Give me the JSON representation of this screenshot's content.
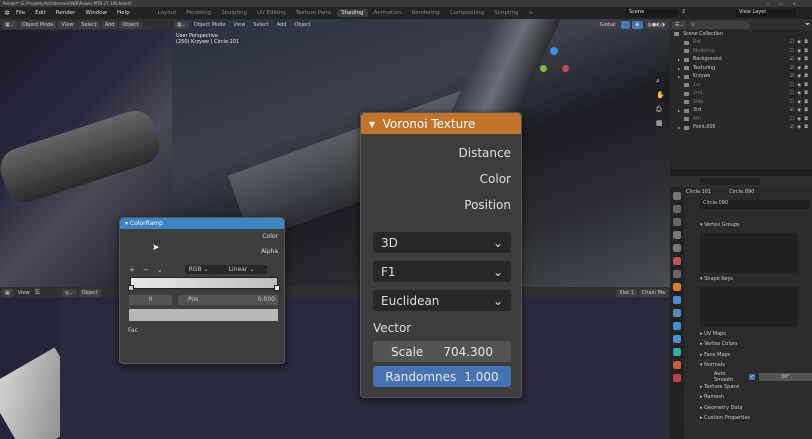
{
  "window": {
    "title": "Render* [E:\\Projekty\\Architecture\\PBR\\Rower MTB 27 100.blend]",
    "controls": [
      "─",
      "☐",
      "✕"
    ]
  },
  "menu": [
    "File",
    "Edit",
    "Render",
    "Window",
    "Help"
  ],
  "workspaces": [
    "Layout",
    "Modeling",
    "Sculpting",
    "UV Editing",
    "Texture Paint",
    "Shading",
    "Animation",
    "Rendering",
    "Compositing",
    "Scripting"
  ],
  "active_workspace": "Shading",
  "scene": {
    "name": "Scene",
    "users": "2",
    "view_layer": "View Layer"
  },
  "left_viewport": {
    "mode": "Object Mode",
    "menus": [
      "View",
      "Select",
      "Add",
      "Object"
    ]
  },
  "main_viewport": {
    "mode": "Object Mode",
    "menus": [
      "View",
      "Select",
      "Add",
      "Object"
    ],
    "orientation": "Global",
    "info_line1": "User Perspective",
    "info_line2": "(250) Krzywe | Circle.101"
  },
  "small_viewport": {
    "menu": "View"
  },
  "node_editor": {
    "mode": "Object",
    "slot": "Slot 1",
    "material": "Chain Ma"
  },
  "outliner": {
    "root": "Scene Collection",
    "items": [
      {
        "label": "Ref",
        "enabled": false
      },
      {
        "label": "Modeling",
        "enabled": false
      },
      {
        "label": "Background",
        "enabled": true
      },
      {
        "label": "Texturing",
        "enabled": true
      },
      {
        "label": "Krzywe",
        "enabled": true
      },
      {
        "label": "1st",
        "enabled": false
      },
      {
        "label": "2nd",
        "enabled": false
      },
      {
        "label": "Side",
        "enabled": false
      },
      {
        "label": "3rd",
        "enabled": true
      },
      {
        "label": "4th",
        "enabled": false
      },
      {
        "label": "Point.005",
        "enabled": true
      }
    ]
  },
  "properties": {
    "object": "Circle.101",
    "mesh": "Circle.090",
    "mesh_field": "Circle.090",
    "sections": {
      "vertex_groups": "Vertex Groups",
      "shape_keys": "Shape Keys",
      "uv_maps": "UV Maps",
      "vertex_colors": "Vertex Colors",
      "face_maps": "Face Maps",
      "normals": "Normals",
      "texture_space": "Texture Space",
      "remesh": "Remesh",
      "geometry_data": "Geometry Data",
      "custom_properties": "Custom Properties"
    },
    "auto_smooth_label": "Auto Smooth",
    "auto_smooth_checked": true,
    "auto_smooth_angle": "30°"
  },
  "voronoi": {
    "title": "Voronoi Texture",
    "outputs": [
      "Distance",
      "Color",
      "Position"
    ],
    "dimensions": "3D",
    "feature": "F1",
    "metric": "Euclidean",
    "vector_label": "Vector",
    "scale_label": "Scale",
    "scale_value": "704.300",
    "randomness_label": "Randomnes",
    "randomness_value": "1.000",
    "header_color": "#c2742d"
  },
  "colorramp": {
    "title": "ColorRamp",
    "outputs": [
      "Color",
      "Alpha"
    ],
    "color_mode": "RGB",
    "interpolation": "Linear",
    "stop_index": "0",
    "pos_label": "Pos",
    "pos_value": "0.000",
    "input_label": "Fac",
    "header_color": "#3f84c4"
  }
}
